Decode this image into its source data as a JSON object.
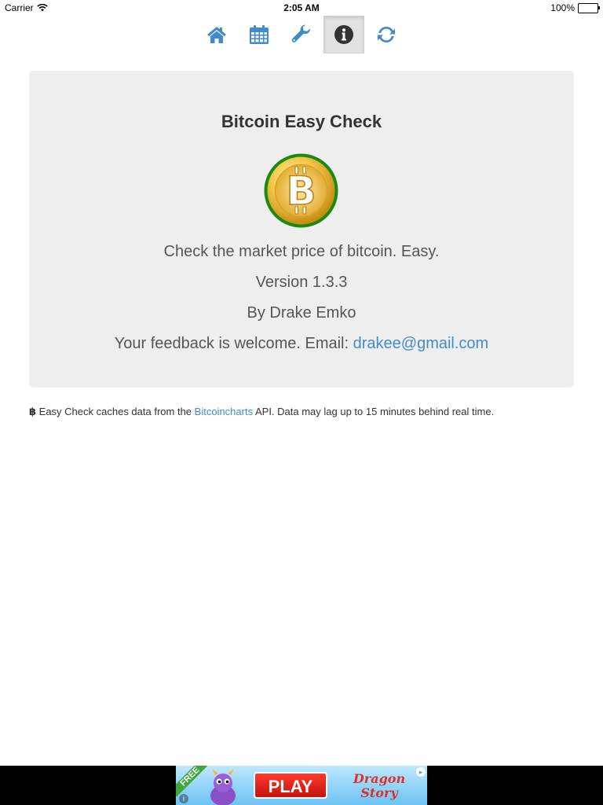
{
  "status_bar": {
    "carrier": "Carrier",
    "time": "2:05 AM",
    "battery": "100%"
  },
  "toolbar": {
    "buttons": [
      {
        "icon": "home-icon",
        "active": false
      },
      {
        "icon": "calendar-icon",
        "active": false
      },
      {
        "icon": "wrench-icon",
        "active": false
      },
      {
        "icon": "info-icon",
        "active": true
      },
      {
        "icon": "refresh-icon",
        "active": false
      }
    ],
    "accent_color": "#428bca"
  },
  "about": {
    "title": "Bitcoin Easy Check",
    "tagline": "Check the market price of bitcoin. Easy.",
    "version": "Version 1.3.3",
    "author": "By Drake Emko",
    "feedback_label": "Your feedback is welcome. Email: ",
    "email": "drakee@gmail.com"
  },
  "note": {
    "symbol": "฿",
    "text_before": " Easy Check caches data from the ",
    "link": "Bitcoincharts",
    "text_after": " API. Data may lag up to 15 minutes behind real time."
  },
  "ad": {
    "badge": "FREE",
    "cta": "PLAY",
    "brand": "Dragon Story"
  }
}
